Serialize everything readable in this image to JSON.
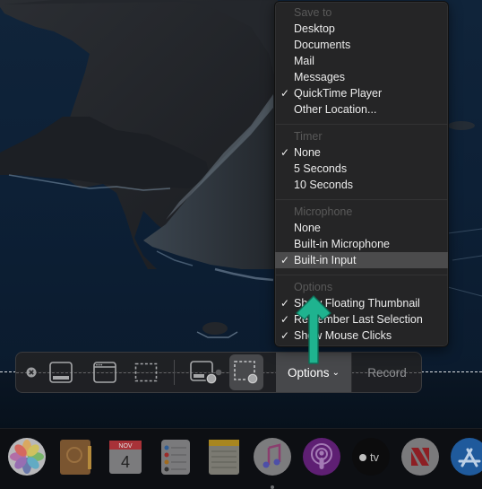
{
  "menu": {
    "sections": [
      {
        "header": "Save to",
        "items": [
          {
            "label": "Desktop",
            "checked": false
          },
          {
            "label": "Documents",
            "checked": false
          },
          {
            "label": "Mail",
            "checked": false
          },
          {
            "label": "Messages",
            "checked": false
          },
          {
            "label": "QuickTime Player",
            "checked": true
          },
          {
            "label": "Other Location...",
            "checked": false
          }
        ]
      },
      {
        "header": "Timer",
        "items": [
          {
            "label": "None",
            "checked": true
          },
          {
            "label": "5 Seconds",
            "checked": false
          },
          {
            "label": "10 Seconds",
            "checked": false
          }
        ]
      },
      {
        "header": "Microphone",
        "items": [
          {
            "label": "None",
            "checked": false
          },
          {
            "label": "Built-in Microphone",
            "checked": false
          },
          {
            "label": "Built-in Input",
            "checked": true,
            "highlighted": true
          }
        ]
      },
      {
        "header": "Options",
        "items": [
          {
            "label": "Show Floating Thumbnail",
            "checked": true
          },
          {
            "label": "Remember Last Selection",
            "checked": true
          },
          {
            "label": "Show Mouse Clicks",
            "checked": true
          }
        ]
      }
    ],
    "check_glyph": "✓"
  },
  "toolbar": {
    "close_icon": "close-circle-icon",
    "capture_entire_screen_icon": "capture-entire-screen-icon",
    "capture_window_icon": "capture-window-icon",
    "capture_selection_icon": "capture-selection-icon",
    "record_entire_screen_icon": "record-entire-screen-icon",
    "record_selection_icon": "record-selection-icon",
    "options_label": "Options",
    "options_chevron": "⌄",
    "record_label": "Record",
    "selected_mode": "record-selection"
  },
  "annotation": {
    "arrow_color": "#1fb38f"
  },
  "dock": {
    "apps": [
      {
        "name": "Photos"
      },
      {
        "name": "Contacts"
      },
      {
        "name": "Calendar",
        "month": "NOV",
        "day": "4"
      },
      {
        "name": "Reminders"
      },
      {
        "name": "Notes"
      },
      {
        "name": "Music",
        "running": true
      },
      {
        "name": "Podcasts"
      },
      {
        "name": "TV",
        "label": "tv"
      },
      {
        "name": "News"
      },
      {
        "name": "App Store"
      }
    ]
  }
}
